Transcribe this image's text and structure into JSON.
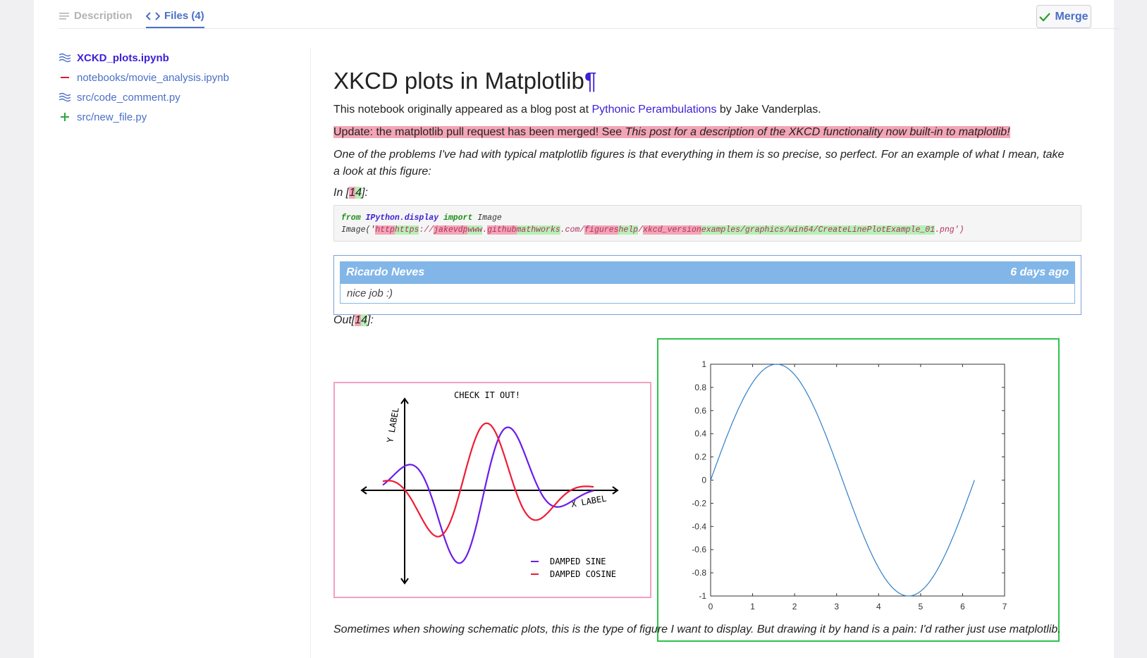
{
  "tabs": {
    "description_label": "Description",
    "files_label": "Files (4)"
  },
  "merge_label": "Merge",
  "files": [
    {
      "name": "XCKD_plots.ipynb",
      "status": "modified"
    },
    {
      "name": "notebooks/movie_analysis.ipynb",
      "status": "deleted"
    },
    {
      "name": "src/code_comment.py",
      "status": "modified"
    },
    {
      "name": "src/new_file.py",
      "status": "added"
    }
  ],
  "notebook": {
    "title": "XKCD plots in Matplotlib",
    "pilcrow": "¶",
    "intro_before": "This notebook originally appeared as a blog post at ",
    "intro_link": "Pythonic Perambulations",
    "intro_after": " by Jake Vanderplas.",
    "update_plain": "Update: the matplotlib pull request has been merged! See ",
    "update_italic": "This post for a description of the XKCD functionality now built-in to matplotlib!",
    "problems_text": "One of the problems I've had with typical matplotlib figures is that everything in them is so precise, so perfect. For an example of what I mean, take a look at this figure:",
    "in_prefix": "In [",
    "in_num_del": "1",
    "in_num_add": "4",
    "in_suffix": "]:",
    "code_line1": {
      "kw1": "from",
      "module": "IPython.display",
      "kw2": "import",
      "name": "Image"
    },
    "code_line2": {
      "prefix": "Image('",
      "del1": "http",
      "add1": "https",
      "sep1": "://",
      "del2": "jakevdp",
      "add2": "www",
      "sep2": ".",
      "del3": "github",
      "add3": "mathworks",
      "sep3": ".com/",
      "del4": "figures",
      "add4": "help",
      "sep4": "/",
      "del5": "xkcd_version",
      "add5": "examples/graphics/win64/CreateLinePlotExample_01",
      "suffix": ".png')"
    },
    "comment": {
      "author": "Ricardo Neves",
      "time": "6 days ago",
      "text": "nice job :)"
    },
    "out_prefix": "Out[",
    "out_num_del": "1",
    "out_num_add": "4",
    "out_suffix": "]:",
    "closing_text": "Sometimes when showing schematic plots, this is the type of figure I want to display. But drawing it by hand is a pain: I'd rather just use matplotlib."
  },
  "xkcd_chart": {
    "title": "CHECK IT OUT!",
    "xlabel": "X LABEL",
    "ylabel": "Y LABEL",
    "legend": [
      "DAMPED SINE",
      "DAMPED COSINE"
    ],
    "colors": {
      "sine": "#6a1de8",
      "cosine": "#ee1c36"
    }
  },
  "chart_data": {
    "type": "line",
    "title": "",
    "xlabel": "",
    "ylabel": "",
    "xlim": [
      0,
      7
    ],
    "ylim": [
      -1,
      1
    ],
    "x_ticks": [
      "0",
      "1",
      "2",
      "3",
      "4",
      "5",
      "6",
      "7"
    ],
    "y_ticks": [
      "1",
      "0.8",
      "0.6",
      "0.4",
      "0.2",
      "0",
      "-0.2",
      "-0.4",
      "-0.6",
      "-0.8",
      "-1"
    ],
    "series": [
      {
        "function": "sin(x)",
        "x_range": [
          0,
          6.2832
        ],
        "color": "#2f7fc8"
      }
    ],
    "grid": false
  }
}
